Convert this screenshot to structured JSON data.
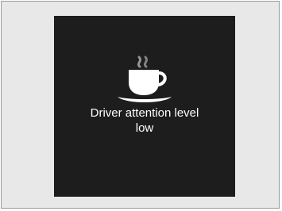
{
  "display": {
    "icon": "coffee-cup-icon",
    "message_line1": "Driver attention level",
    "message_line2": "low",
    "background_color": "#1e1d1d",
    "frame_color": "#e8e8e8",
    "text_color": "#ffffff"
  }
}
